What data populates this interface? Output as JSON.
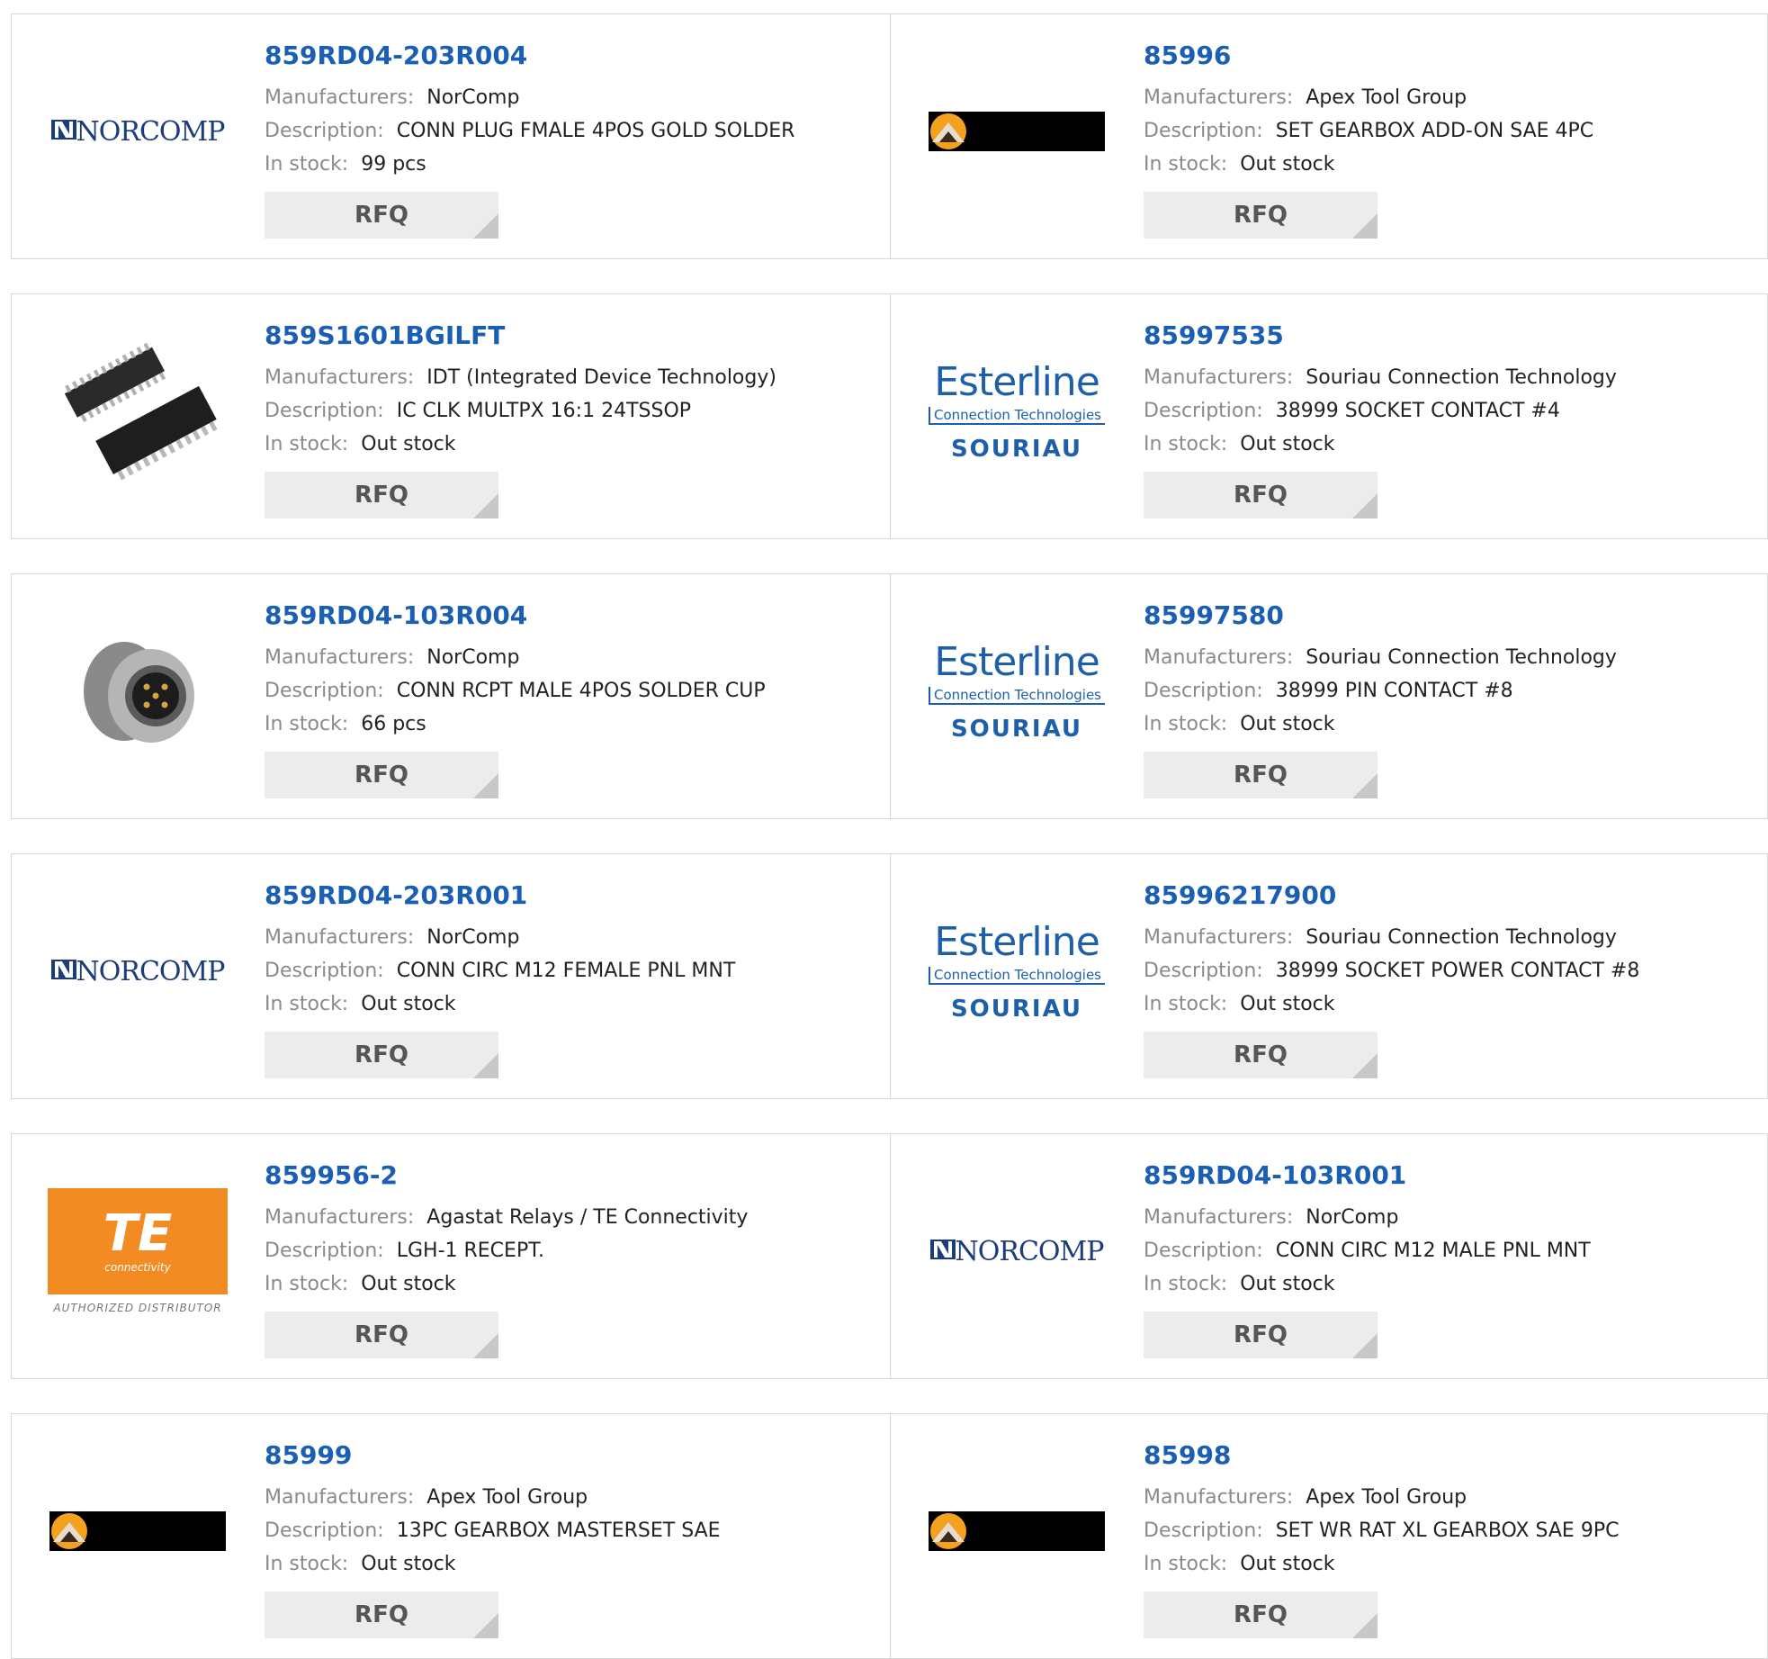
{
  "labels": {
    "manufacturers": "Manufacturers:",
    "description": "Description:",
    "in_stock": "In stock:",
    "rfq": "RFQ"
  },
  "logos": {
    "norcomp": "NORCOMP",
    "esterline": "Esterline",
    "esterline_sub": "Connection Technologies",
    "souriau": "SOURIAU",
    "te": "TE",
    "te_sub": "connectivity",
    "te_auth": "AUTHORIZED DISTRIBUTOR"
  },
  "colors": {
    "link": "#1a5fb4",
    "te_orange": "#f28c22",
    "rfq_bg": "#ececec"
  },
  "products": [
    {
      "part": "859RD04-203R004",
      "manufacturer": "NorComp",
      "description": "CONN PLUG FMALE 4POS GOLD SOLDER",
      "stock": "99 pcs",
      "logo": "norcomp"
    },
    {
      "part": "85996",
      "manufacturer": "Apex Tool Group",
      "description": "SET GEARBOX ADD-ON SAE 4PC",
      "stock": "Out stock",
      "logo": "apex"
    },
    {
      "part": "859S1601BGILFT",
      "manufacturer": "IDT (Integrated Device Technology)",
      "description": "IC CLK MULTPX 16:1 24TSSOP",
      "stock": "Out stock",
      "logo": "chip-photo"
    },
    {
      "part": "85997535",
      "manufacturer": "Souriau Connection Technology",
      "description": "38999 SOCKET CONTACT #4",
      "stock": "Out stock",
      "logo": "esterline"
    },
    {
      "part": "859RD04-103R004",
      "manufacturer": "NorComp",
      "description": "CONN RCPT MALE 4POS SOLDER CUP",
      "stock": "66 pcs",
      "logo": "connector-photo"
    },
    {
      "part": "85997580",
      "manufacturer": "Souriau Connection Technology",
      "description": "38999 PIN CONTACT #8",
      "stock": "Out stock",
      "logo": "esterline"
    },
    {
      "part": "859RD04-203R001",
      "manufacturer": "NorComp",
      "description": "CONN CIRC M12 FEMALE PNL MNT",
      "stock": "Out stock",
      "logo": "norcomp"
    },
    {
      "part": "85996217900",
      "manufacturer": "Souriau Connection Technology",
      "description": "38999 SOCKET POWER CONTACT #8",
      "stock": "Out stock",
      "logo": "esterline"
    },
    {
      "part": "859956-2",
      "manufacturer": "Agastat Relays / TE Connectivity",
      "description": "LGH-1 RECEPT.",
      "stock": "Out stock",
      "logo": "te"
    },
    {
      "part": "859RD04-103R001",
      "manufacturer": "NorComp",
      "description": "CONN CIRC M12 MALE PNL MNT",
      "stock": "Out stock",
      "logo": "norcomp"
    },
    {
      "part": "85999",
      "manufacturer": "Apex Tool Group",
      "description": "13PC GEARBOX MASTERSET SAE",
      "stock": "Out stock",
      "logo": "apex"
    },
    {
      "part": "85998",
      "manufacturer": "Apex Tool Group",
      "description": "SET WR RAT XL GEARBOX SAE 9PC",
      "stock": "Out stock",
      "logo": "apex"
    }
  ]
}
